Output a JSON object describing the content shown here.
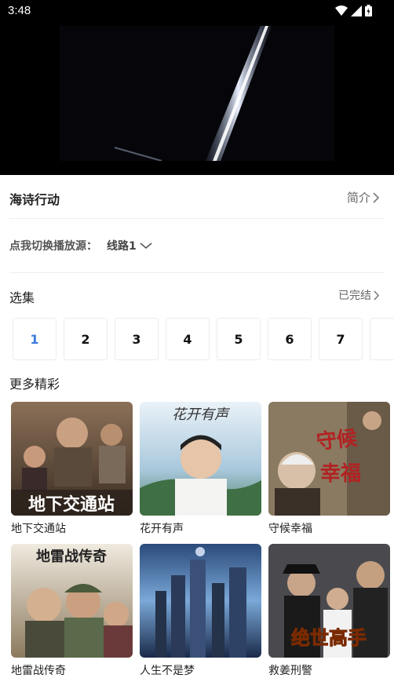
{
  "status_bar": {
    "time": "3:48",
    "icons": [
      "wifi-icon",
      "signal-icon",
      "battery-icon"
    ]
  },
  "video": {
    "state": "playing"
  },
  "show": {
    "title": "海诗行动",
    "intro_label": "简介"
  },
  "source": {
    "label": "点我切换播放源：",
    "value": "线路1"
  },
  "episodes": {
    "title": "选集",
    "status": "已完结",
    "items": [
      "1",
      "2",
      "3",
      "4",
      "5",
      "6",
      "7"
    ],
    "active_index": 0
  },
  "more": {
    "title": "更多精彩",
    "items": [
      {
        "title": "地下交通站",
        "poster_text": "地下交通站"
      },
      {
        "title": "花开有声",
        "poster_text": "花开有声"
      },
      {
        "title": "守候幸福",
        "poster_text": "守候幸福"
      },
      {
        "title": "地雷战传奇",
        "poster_text": "地雷战传奇"
      },
      {
        "title": "人生不是梦",
        "poster_text": ""
      },
      {
        "title": "救姜刑警",
        "poster_text": "绝世高手"
      }
    ]
  },
  "colors": {
    "accent": "#3b7be0",
    "divider": "#eeeeee",
    "video_bg": "#000000"
  }
}
